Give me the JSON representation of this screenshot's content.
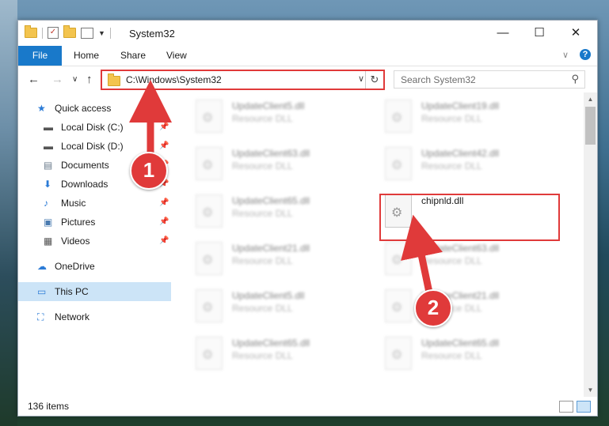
{
  "window": {
    "title": "System32"
  },
  "ribbon": {
    "tabs": [
      "File",
      "Home",
      "Share",
      "View"
    ]
  },
  "address": {
    "path": "C:\\Windows\\System32"
  },
  "search": {
    "placeholder": "Search System32"
  },
  "nav_pane": {
    "items": [
      {
        "label": "Quick access",
        "icon": "star-icon",
        "pinned": false
      },
      {
        "label": "Local Disk (C:)",
        "icon": "drive-icon",
        "pinned": true
      },
      {
        "label": "Local Disk (D:)",
        "icon": "drive-icon",
        "pinned": true
      },
      {
        "label": "Documents",
        "icon": "documents-icon",
        "pinned": true
      },
      {
        "label": "Downloads",
        "icon": "download-icon",
        "pinned": true
      },
      {
        "label": "Music",
        "icon": "music-icon",
        "pinned": true
      },
      {
        "label": "Pictures",
        "icon": "pictures-icon",
        "pinned": true
      },
      {
        "label": "Videos",
        "icon": "videos-icon",
        "pinned": true
      },
      {
        "label": "OneDrive",
        "icon": "cloud-icon",
        "pinned": false
      },
      {
        "label": "This PC",
        "icon": "computer-icon",
        "pinned": false,
        "selected": true
      },
      {
        "label": "Network",
        "icon": "network-icon",
        "pinned": false
      }
    ]
  },
  "files": [
    {
      "name": "UpdateClient5.dll",
      "type": "Resource DLL",
      "blurred": true
    },
    {
      "name": "UpdateClient19.dll",
      "type": "Resource DLL",
      "blurred": true
    },
    {
      "name": "UpdateClient63.dll",
      "type": "Resource DLL",
      "blurred": true
    },
    {
      "name": "UpdateClient42.dll",
      "type": "Resource DLL",
      "blurred": true
    },
    {
      "name": "UpdateClient65.dll",
      "type": "Resource DLL",
      "blurred": true
    },
    {
      "name": "chipnld.dll",
      "type": "",
      "blurred": false,
      "highlighted": true
    },
    {
      "name": "UpdateClient21.dll",
      "type": "Resource DLL",
      "blurred": true
    },
    {
      "name": "UpdateClient63.dll",
      "type": "Resource DLL",
      "blurred": true
    },
    {
      "name": "UpdateClient5.dll",
      "type": "Resource DLL",
      "blurred": true
    },
    {
      "name": "UpdateClient21.dll",
      "type": "Resource DLL",
      "blurred": true
    },
    {
      "name": "UpdateClient65.dll",
      "type": "Resource DLL",
      "blurred": true
    },
    {
      "name": "UpdateClient65.dll",
      "type": "Resource DLL",
      "blurred": true
    }
  ],
  "status": {
    "item_count": "136 items"
  },
  "callouts": [
    "1",
    "2"
  ],
  "colors": {
    "accent": "#1979ca",
    "highlight": "#e03a3a",
    "selected": "#cce4f7"
  }
}
